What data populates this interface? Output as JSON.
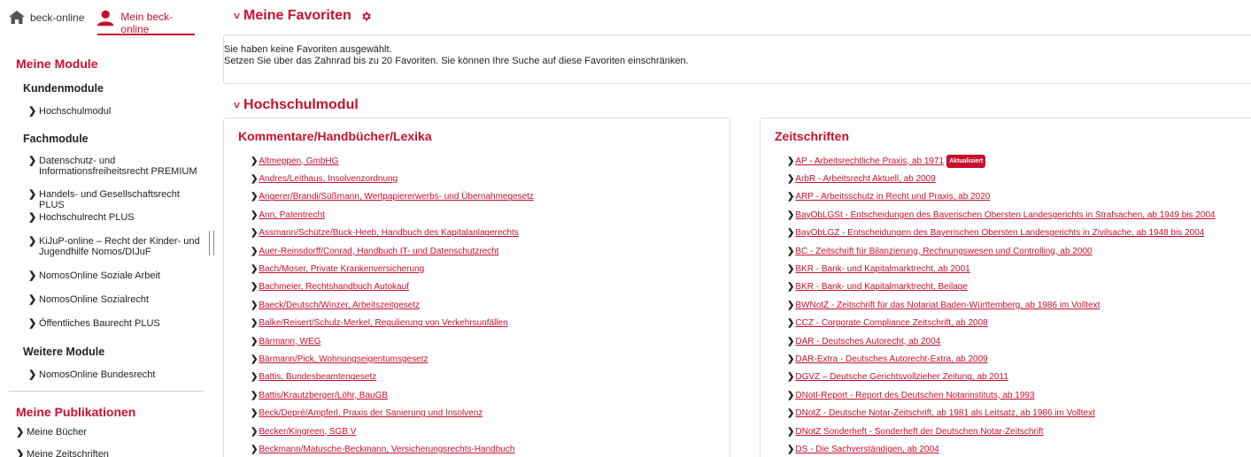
{
  "topnav": {
    "home_label": "beck-online",
    "mine_label": "Mein beck-online"
  },
  "sidebar": {
    "modules_title": "Meine Module",
    "kunden_title": "Kundenmodule",
    "kunden_items": [
      "Hochschulmodul"
    ],
    "fach_title": "Fachmodule",
    "fach_items": [
      "Datenschutz- und Informationsfreiheitsrecht PREMIUM",
      "Handels- und Gesellschaftsrecht PLUS",
      "Hochschulrecht PLUS",
      "KiJuP-online – Recht der Kinder- und Jugendhilfe Nomos/DIJuF",
      "NomosOnline Soziale Arbeit",
      "NomosOnline Sozialrecht",
      "Öffentliches Baurecht PLUS"
    ],
    "weitere_title": "Weitere Module",
    "weitere_items": [
      "NomosOnline Bundesrecht"
    ],
    "publications_title": "Meine Publikationen",
    "publication_items": [
      "Meine Bücher",
      "Meine Zeitschriften"
    ]
  },
  "favorites": {
    "title": "Meine Favoriten",
    "line1": "Sie haben keine Favoriten ausgewählt.",
    "line2": "Setzen Sie über das Zahnrad bis zu 20 Favoriten. Sie können Ihre Suche auf diese Favoriten einschränken."
  },
  "hochschulmodul": {
    "title": "Hochschulmodul",
    "left": {
      "title": "Kommentare/Handbücher/Lexika",
      "items": [
        "Altmeppen, GmbHG",
        "Andres/Leithaus, Insolvenzordnung",
        "Angerer/Brandi/Süßmann, Wertpapiererwerbs- und Übernahmegesetz",
        "Ann, Patentrecht",
        "Assmann/Schütze/Buck-Heeb, Handbuch des Kapitalanlagerechts",
        "Auer-Reinsdorff/Conrad, Handbuch IT- und Datenschutzrecht",
        "Bach/Moser, Private Krankenversicherung",
        "Bachmeier, Rechtshandbuch Autokauf",
        "Baeck/Deutsch/Winzer, Arbeitszeitgesetz",
        "Balke/Reisert/Schulz-Merkel, Regulierung von Verkehrsunfällen",
        "Bärmann, WEG",
        "Bärmann/Pick, Wohnungseigentumsgesetz",
        "Battis, Bundesbeamtengesetz",
        "Battis/Krautzberger/Löhr, BauGB",
        "Beck/Depré/Ampferl, Praxis der Sanierung und Insolvenz",
        "Becker/Kingreen, SGB V",
        "Beckmann/Matusche-Beckmann, Versicherungsrechts-Handbuch"
      ]
    },
    "right": {
      "title": "Zeitschriften",
      "badge": "Aktualisiert",
      "items": [
        "AP - Arbeitsrechtliche Praxis, ab 1971",
        "ArbR - Arbeitsrecht Aktuell, ab 2009",
        "ARP - Arbeitsschutz in Recht und Praxis, ab 2020",
        "BayObLGSt - Entscheidungen des Bayerischen Obersten Landesgerichts in Strafsachen, ab 1949 bis 2004",
        "BayObLGZ - Entscheidungen des Bayerischen Obersten Landesgerichts in Zivilsache, ab 1948 bis 2004",
        "BC - Zeitschrift für Bilanzierung, Rechnungswesen und Controlling, ab 2000",
        "BKR - Bank- und Kapitalmarktrecht, ab 2001",
        "BKR - Bank- und Kapitalmarktrecht, Beilage",
        "BWNotZ - Zeitschrift für das Notariat Baden-Württemberg, ab 1986 im Volltext",
        "CCZ - Corporate Compliance Zeitschrift, ab 2008",
        "DAR - Deutsches Autorecht, ab 2004",
        "DAR-Extra - Deutsches Autorecht-Extra, ab 2009",
        "DGVZ – Deutsche Gerichtsvollzieher Zeitung, ab 2011",
        "DNotI-Report - Report des Deutschen Notarinstituts, ab 1993",
        "DNotZ - Deutsche Notar-Zeitschrift, ab 1981 als Leitsatz, ab 1986 im Volltext",
        "DNotZ Sonderheft - Sonderheft der Deutschen Notar-Zeitschrift",
        "DS - Die Sachverständigen, ab 2004"
      ]
    }
  },
  "colors": {
    "brand": "#c8102e"
  }
}
